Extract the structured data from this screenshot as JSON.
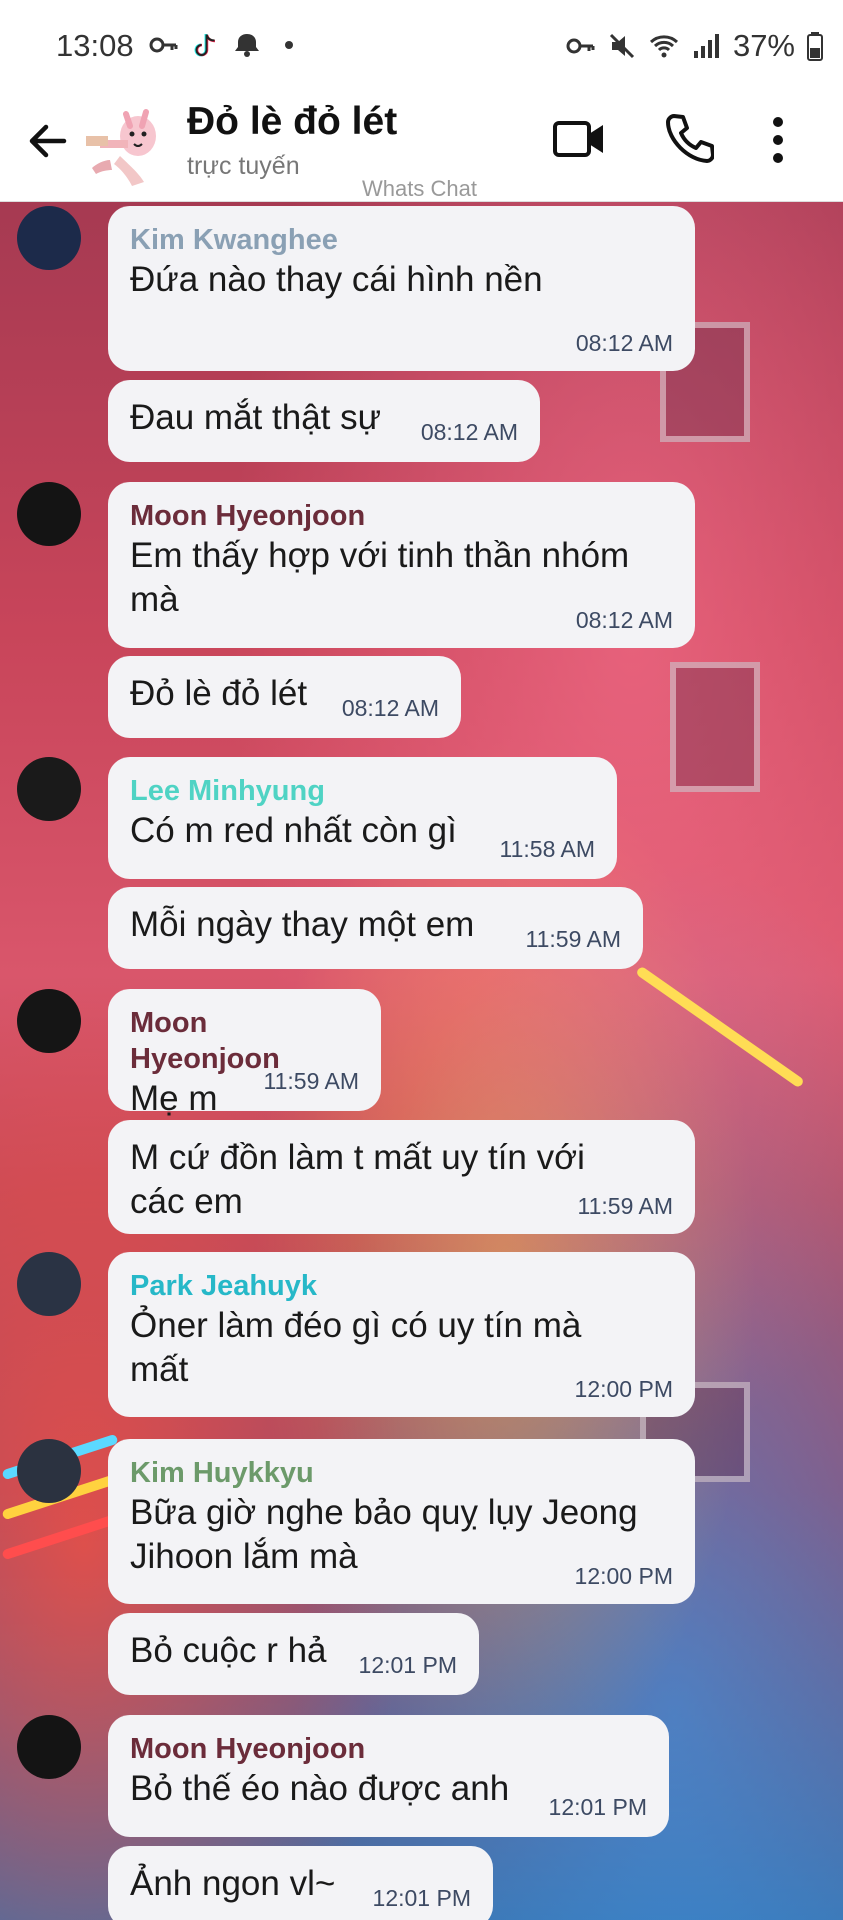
{
  "status_bar": {
    "time": "13:08",
    "battery": "37%"
  },
  "header": {
    "title": "Đỏ lè đỏ lét",
    "status": "trực tuyến",
    "watermark": "Whats Chat"
  },
  "icons": {
    "back": "arrow-left-icon",
    "video": "video-camera-icon",
    "call": "phone-icon",
    "more": "more-vertical-icon"
  },
  "colors": {
    "bubble": "#f3f3f6",
    "time": "#3d4a63",
    "sender_kim_kwanghee": "#8aa0b4",
    "sender_moon": "#6b2c3a",
    "sender_lee": "#4fd3c4",
    "sender_park": "#26b8c8",
    "sender_kim_huykkyu": "#6c9a6a"
  },
  "messages": [
    {
      "sender": "Kim Kwanghee",
      "text": "Đứa nào thay cái hình nền",
      "time": "08:12 AM"
    },
    {
      "sender": "",
      "text": "Đau mắt thật sự",
      "time": "08:12 AM"
    },
    {
      "sender": "Moon Hyeonjoon",
      "text": "Em thấy hợp với tinh thần nhóm mà",
      "time": "08:12 AM"
    },
    {
      "sender": "",
      "text": "Đỏ lè đỏ lét",
      "time": "08:12 AM"
    },
    {
      "sender": "Lee Minhyung",
      "text": "Có m red nhất còn gì",
      "time": "11:58 AM"
    },
    {
      "sender": "",
      "text": "Mỗi ngày thay một em",
      "time": "11:59 AM"
    },
    {
      "sender": "Moon Hyeonjoon",
      "text": "Mẹ m",
      "time": "11:59 AM"
    },
    {
      "sender": "",
      "text": "M cứ đồn làm t mất uy tín với các em",
      "time": "11:59 AM"
    },
    {
      "sender": "Park Jeahuyk",
      "text": "Ỏner làm đéo gì có uy tín mà mất",
      "time": "12:00 PM"
    },
    {
      "sender": "Kim Huykkyu",
      "text": "Bữa giờ nghe bảo quỵ lụy Jeong Jihoon lắm mà",
      "time": "12:00 PM"
    },
    {
      "sender": "",
      "text": "Bỏ cuộc r hả",
      "time": "12:01 PM"
    },
    {
      "sender": "Moon Hyeonjoon",
      "text": "Bỏ thế éo nào được anh",
      "time": "12:01 PM"
    },
    {
      "sender": "",
      "text": "Ảnh ngon vl~",
      "time": "12:01 PM"
    }
  ]
}
